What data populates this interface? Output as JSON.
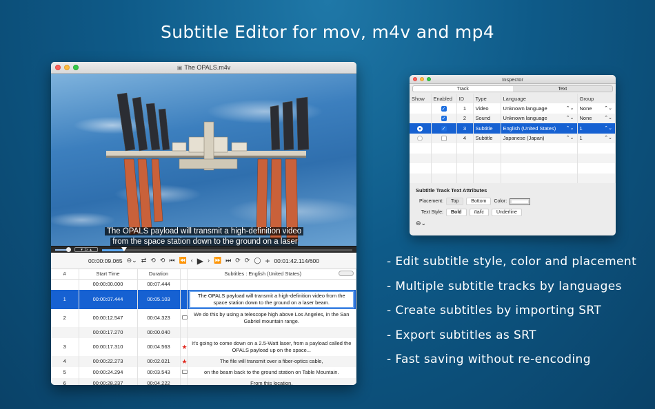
{
  "headline": "Subtitle Editor for mov, m4v and mp4",
  "editor": {
    "window_title": "The OPALS.m4v",
    "video_subtitle_line1": "The OPALS payload will transmit a high-definition video",
    "video_subtitle_line2": "from the space station down to the ground on a laser beam.",
    "playback_rate": "1x",
    "playback_progress_fraction": 0.088,
    "current_time": "00:00:09.065",
    "total_time": "00:01:42.114/600",
    "columns": [
      "#",
      "Start Time",
      "Duration",
      "Subtitles : English (United States)"
    ],
    "rows": [
      {
        "num": "",
        "start": "00:00:00.000",
        "dur": "00:07.444",
        "mark": "",
        "text": ""
      },
      {
        "num": "1",
        "start": "00:00:07.444",
        "dur": "00:05.103",
        "mark": "",
        "text": "The OPALS payload will transmit a high-definition video from the space station down to the ground on a laser beam."
      },
      {
        "num": "2",
        "start": "00:00:12.547",
        "dur": "00:04.323",
        "mark": "note",
        "text": "We do this by using a telescope high above Los Angeles, in the San Gabriel mountain range."
      },
      {
        "num": "",
        "start": "00:00:17.270",
        "dur": "00:00.040",
        "mark": "",
        "text": ""
      },
      {
        "num": "3",
        "start": "00:00:17.310",
        "dur": "00:04.563",
        "mark": "star",
        "text": "It's going to come down on a 2.5-Watt laser, from a payload called the OPALS payload up on the space..."
      },
      {
        "num": "4",
        "start": "00:00:22.273",
        "dur": "00:02.021",
        "mark": "star",
        "text": "The file will transmit over a fiber-optics cable,"
      },
      {
        "num": "5",
        "start": "00:00:24.294",
        "dur": "00:03.543",
        "mark": "note",
        "text": "on the beam back to the ground station on Table Mountain."
      },
      {
        "num": "6",
        "start": "00:00:28.237",
        "dur": "00:04.222",
        "mark": "",
        "text": "From this location,"
      }
    ]
  },
  "inspector": {
    "title": "Inspector",
    "tabs": [
      "Track",
      "Text"
    ],
    "columns": [
      "Show",
      "Enabled",
      "ID",
      "Type",
      "Language",
      "Group"
    ],
    "tracks": [
      {
        "show": false,
        "enabled": true,
        "id": "1",
        "type": "Video",
        "language": "Unknown language",
        "group": "None"
      },
      {
        "show": false,
        "enabled": true,
        "id": "2",
        "type": "Sound",
        "language": "Unknown language",
        "group": "None"
      },
      {
        "show": true,
        "enabled": true,
        "id": "3",
        "type": "Subtitle",
        "language": "English (United States)",
        "group": "1"
      },
      {
        "show": false,
        "enabled": false,
        "id": "4",
        "type": "Subtitle",
        "language": "Japanese (Japan)",
        "group": "1"
      }
    ],
    "attributes_heading": "Subtitle Track Text Attributes",
    "placement_label": "Placement:",
    "placement_top": "Top",
    "placement_bottom": "Bottom",
    "color_label": "Color:",
    "text_style_label": "Text Style:",
    "style_bold": "Bold",
    "style_italic": "Italic",
    "style_underline": "Underline"
  },
  "features": [
    "- Edit subtitle style, color and placement",
    "- Multiple subtitle tracks by languages",
    "- Create subtitles by importing SRT",
    "- Export subtitles as SRT",
    "- Fast saving without re-encoding"
  ]
}
